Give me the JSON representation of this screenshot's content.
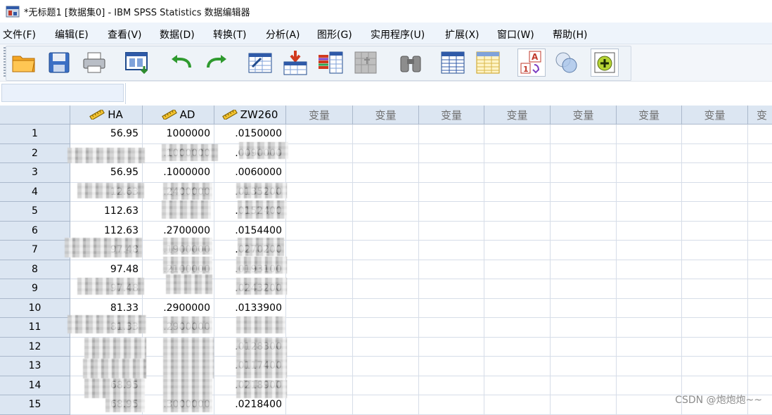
{
  "window": {
    "title": "*无标题1 [数据集0] - IBM SPSS Statistics 数据编辑器"
  },
  "menu": [
    {
      "label": "文件(F)"
    },
    {
      "label": "编辑(E)"
    },
    {
      "label": "查看(V)"
    },
    {
      "label": "数据(D)"
    },
    {
      "label": "转换(T)"
    },
    {
      "label": "分析(A)"
    },
    {
      "label": "图形(G)"
    },
    {
      "label": "实用程序(U)"
    },
    {
      "label": "扩展(X)"
    },
    {
      "label": "窗口(W)"
    },
    {
      "label": "帮助(H)"
    }
  ],
  "toolbar": [
    {
      "icon": "open-folder-icon"
    },
    {
      "icon": "save-icon"
    },
    {
      "icon": "print-icon"
    },
    {
      "icon": "recall-dialog-icon"
    },
    {
      "icon": "undo-icon"
    },
    {
      "icon": "redo-icon"
    },
    {
      "icon": "go-to-case-icon"
    },
    {
      "icon": "insert-cases-icon"
    },
    {
      "icon": "insert-variable-icon"
    },
    {
      "icon": "split-file-icon"
    },
    {
      "icon": "find-icon"
    },
    {
      "icon": "select-cases-icon"
    },
    {
      "icon": "weight-cases-icon"
    },
    {
      "icon": "value-labels-icon"
    },
    {
      "icon": "use-variable-sets-icon"
    },
    {
      "icon": "add-on-icon"
    }
  ],
  "grid": {
    "columns": [
      {
        "label": "HA",
        "type": "scale"
      },
      {
        "label": "AD",
        "type": "scale"
      },
      {
        "label": "ZW260",
        "type": "scale"
      },
      {
        "label": "变量",
        "type": "empty"
      },
      {
        "label": "变量",
        "type": "empty"
      },
      {
        "label": "变量",
        "type": "empty"
      },
      {
        "label": "变量",
        "type": "empty"
      },
      {
        "label": "变量",
        "type": "empty"
      },
      {
        "label": "变量",
        "type": "empty"
      },
      {
        "label": "变量",
        "type": "empty"
      },
      {
        "label": "变",
        "type": "empty"
      }
    ],
    "rows": [
      {
        "n": "1",
        "cells": [
          "56.95",
          "1000000",
          ".0150000"
        ]
      },
      {
        "n": "2",
        "cells": [
          "",
          ".1000000",
          ".0090000"
        ]
      },
      {
        "n": "3",
        "cells": [
          "56.95",
          ".1000000",
          ".0060000"
        ]
      },
      {
        "n": "4",
        "cells": [
          "12.63",
          ".2400000",
          ".0135200"
        ]
      },
      {
        "n": "5",
        "cells": [
          "112.63",
          "",
          ".0152400"
        ]
      },
      {
        "n": "6",
        "cells": [
          "112.63",
          ".2700000",
          ".0154400"
        ]
      },
      {
        "n": "7",
        "cells": [
          "97.48",
          ".1900000",
          ".0270200"
        ]
      },
      {
        "n": "8",
        "cells": [
          "97.48",
          ".2100000",
          ".0193100"
        ]
      },
      {
        "n": "9",
        "cells": [
          "97.48",
          "",
          ".0243200"
        ]
      },
      {
        "n": "10",
        "cells": [
          "81.33",
          ".2900000",
          ".0133900"
        ]
      },
      {
        "n": "11",
        "cells": [
          "81.33",
          ".2900000",
          ""
        ]
      },
      {
        "n": "12",
        "cells": [
          "",
          "",
          ".0128300"
        ]
      },
      {
        "n": "13",
        "cells": [
          "",
          "",
          ".0117400"
        ]
      },
      {
        "n": "14",
        "cells": [
          "68.95",
          "",
          ".0218900"
        ]
      },
      {
        "n": "15",
        "cells": [
          "68.95",
          ".3000000",
          ".0218400"
        ]
      }
    ]
  },
  "watermark": "CSDN @炮炮炮~~"
}
